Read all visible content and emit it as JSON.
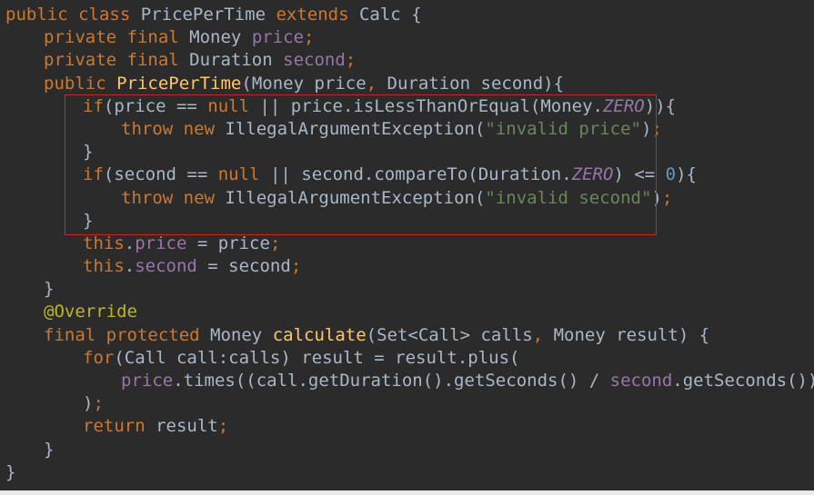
{
  "code": {
    "l1": {
      "a": "public",
      "b": " ",
      "c": "class",
      "d": " PricePerTime ",
      "e": "extends",
      "f": " Calc {"
    },
    "l2": {
      "a": "private",
      "b": " ",
      "c": "final",
      "d": " Money ",
      "e": "price",
      "f": ";"
    },
    "l3": {
      "a": "private",
      "b": " ",
      "c": "final",
      "d": " Duration ",
      "e": "second",
      "f": ";"
    },
    "l4": {
      "a": "public",
      "b": " ",
      "c": "PricePerTime",
      "d": "(Money price",
      "e": ",",
      "f": " Duration second){"
    },
    "l5": {
      "a": "if",
      "b": "(price == ",
      "c": "null",
      "d": " || price.isLessThanOrEqual(Money.",
      "e": "ZERO",
      "f": ")){"
    },
    "l6": {
      "a": "throw",
      "b": " ",
      "c": "new",
      "d": " IllegalArgumentException(",
      "e": "\"invalid price\"",
      "f": ")",
      "g": ";"
    },
    "l7": {
      "a": "}"
    },
    "l8": {
      "a": "if",
      "b": "(second == ",
      "c": "null",
      "d": " || second.compareTo(Duration.",
      "e": "ZERO",
      "f": ") <= ",
      "g": "0",
      "h": "){"
    },
    "l9": {
      "a": "throw",
      "b": " ",
      "c": "new",
      "d": " IllegalArgumentException(",
      "e": "\"invalid second\"",
      "f": ")",
      "g": ";"
    },
    "l10": {
      "a": "}"
    },
    "l11": {
      "a": "this",
      "b": ".",
      "c": "price",
      "d": " = price",
      "e": ";"
    },
    "l12": {
      "a": "this",
      "b": ".",
      "c": "second",
      "d": " = second",
      "e": ";"
    },
    "l13": {
      "a": "}"
    },
    "l14": {
      "a": "@Override"
    },
    "l15": {
      "a": "final",
      "b": " ",
      "c": "protected",
      "d": " Money ",
      "e": "calculate",
      "f": "(Set<Call> calls",
      "g": ",",
      "h": " Money result) {"
    },
    "l16": {
      "a": "for",
      "b": "(Call call:calls) result = result.plus("
    },
    "l17": {
      "a": "price",
      "b": ".times((call.getDuration().getSeconds() / ",
      "c": "second",
      "d": ".getSeconds()))"
    },
    "l18": {
      "a": ")",
      "b": ";"
    },
    "l19": {
      "a": "return",
      "b": " result",
      "c": ";"
    },
    "l20": {
      "a": "}"
    },
    "l21": {
      "a": "}"
    }
  },
  "colors": {
    "background": "#2b2b2b",
    "text": "#a9b7c6",
    "keyword": "#cc7832",
    "method": "#ffc66d",
    "string": "#6a8759",
    "field": "#9876aa",
    "number": "#6897bb",
    "annotation": "#bbb529",
    "highlight_box": "#c62828"
  }
}
